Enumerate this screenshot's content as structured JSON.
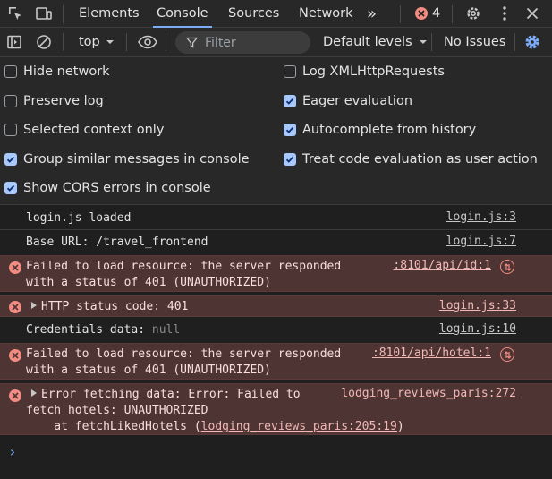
{
  "tabs": {
    "elements": "Elements",
    "console": "Console",
    "sources": "Sources",
    "network": "Network",
    "more": "»",
    "error_count": "4"
  },
  "toolbar": {
    "context": "top",
    "filter_placeholder": "Filter",
    "levels": "Default levels",
    "issues": "No Issues"
  },
  "settings": {
    "hide_network": "Hide network",
    "preserve_log": "Preserve log",
    "selected_context": "Selected context only",
    "group_similar": "Group similar messages in console",
    "show_cors": "Show CORS errors in console",
    "log_xhr": "Log XMLHttpRequests",
    "eager_eval": "Eager evaluation",
    "autocomplete": "Autocomplete from history",
    "treat_user_action": "Treat code evaluation as user action"
  },
  "console": {
    "m1": "login.js loaded",
    "s1": "login.js:3",
    "m2": "Base URL: /travel_frontend",
    "s2": "login.js:7",
    "m3a": "Failed to load resource: the server responded",
    "m3b": "with a status of 401 (UNAUTHORIZED)",
    "s3": ":8101/api/id:1",
    "m4": "HTTP status code: 401",
    "s4": "login.js:33",
    "m5_label": "Credentials data: ",
    "m5_value": "null",
    "s5": "login.js:10",
    "m6a": "Failed to load resource: the server responded",
    "m6b": "with a status of 401 (UNAUTHORIZED)",
    "s6": ":8101/api/hotel:1",
    "m7a": "Error fetching data: Error: Failed to",
    "m7b": "fetch hotels: UNAUTHORIZED",
    "m7c_pre": "    at fetchLikedHotels (",
    "m7c_link": "lodging_reviews_paris:205:19",
    "m7c_post": ")",
    "s7": "lodging_reviews_paris:272",
    "prompt": "›"
  }
}
